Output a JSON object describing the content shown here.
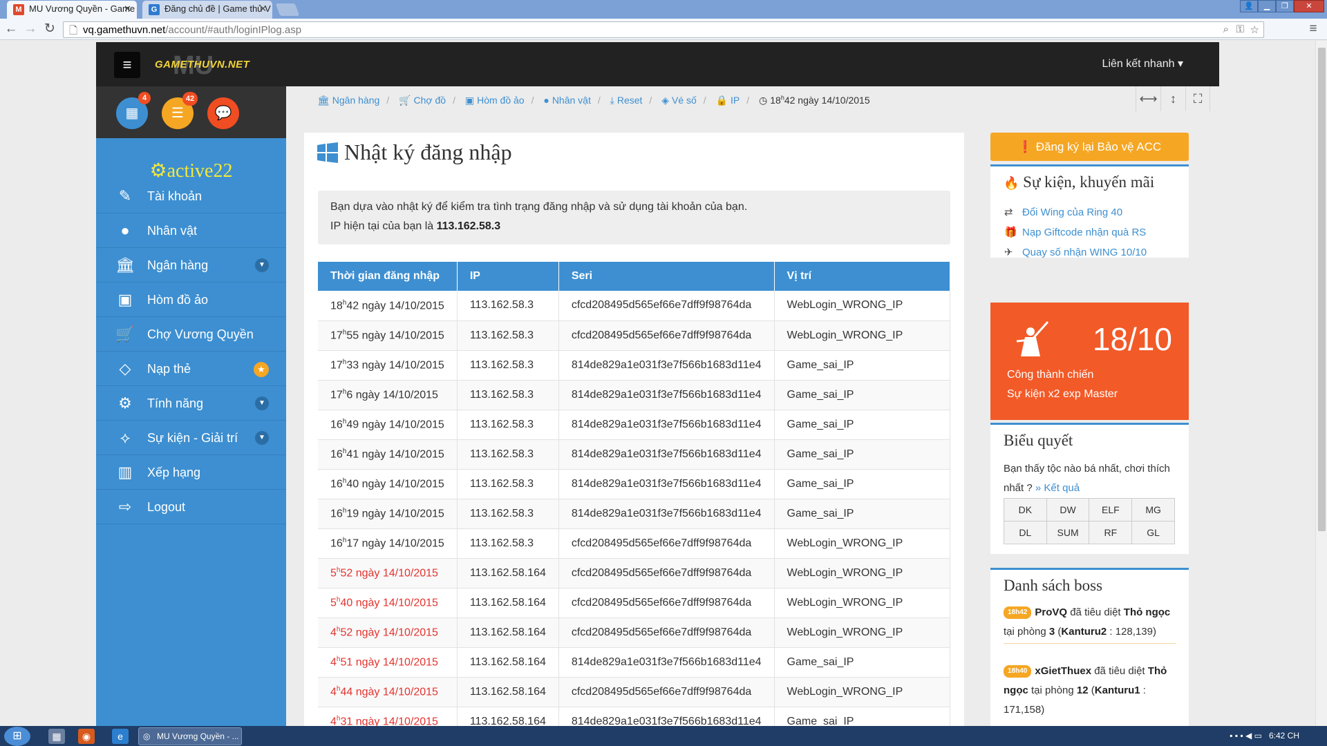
{
  "browser": {
    "tabs": [
      {
        "title": "MU Vương Quyền - Game",
        "close": "✕"
      },
      {
        "title": "Đăng chủ đề | Game thủ V",
        "close": "✕"
      }
    ],
    "url_host": "vq.gamethuvn.net",
    "url_path": "/account/#auth/loginIPlog.asp"
  },
  "header": {
    "logo_text": "GAMETHUVN.NET",
    "quick_links": "Liên kết nhanh ▾"
  },
  "sidebar": {
    "badges": [
      "4",
      "42"
    ],
    "username": "active22",
    "items": [
      {
        "label": "Tài khoản",
        "icon": "edit-icon"
      },
      {
        "label": "Nhân vật",
        "icon": "user-icon"
      },
      {
        "label": "Ngân hàng",
        "icon": "bank-icon"
      },
      {
        "label": "Hòm đồ ảo",
        "icon": "briefcase-icon"
      },
      {
        "label": "Chợ Vương Quyền",
        "icon": "cart-icon"
      },
      {
        "label": "Nạp thẻ",
        "icon": "diamond-icon"
      },
      {
        "label": "Tính năng",
        "icon": "gears-icon"
      },
      {
        "label": "Sự kiện - Giải trí",
        "icon": "handshake-icon"
      },
      {
        "label": "Xếp hạng",
        "icon": "bar-chart-icon"
      },
      {
        "label": "Logout",
        "icon": "logout-icon"
      }
    ]
  },
  "breadcrumbs": [
    {
      "label": "Ngân hàng"
    },
    {
      "label": "Chợ đồ"
    },
    {
      "label": "Hòm đồ ảo"
    },
    {
      "label": "Nhân vật"
    },
    {
      "label": "Reset"
    },
    {
      "label": "Vé số"
    },
    {
      "label": "IP"
    }
  ],
  "clock": {
    "hour": "18",
    "unit": "h",
    "rest": "42 ngày 14/10/2015"
  },
  "main": {
    "title": "Nhật ký đăng nhập",
    "info_line1": "Bạn dựa vào nhật ký để kiểm tra tình trạng đăng nhập và sử dụng tài khoản của bạn.",
    "info_line2_prefix": "IP hiện tại của bạn là ",
    "current_ip": "113.162.58.3"
  },
  "table": {
    "headers": [
      "Thời gian đăng nhập",
      "IP",
      "Seri",
      "Vị trí"
    ],
    "rows": [
      {
        "h": "18",
        "rest": "42 ngày 14/10/2015",
        "ip": "113.162.58.3",
        "seri": "cfcd208495d565ef66e7dff9f98764da",
        "pos": "WebLogin_WRONG_IP",
        "warn": false
      },
      {
        "h": "17",
        "rest": "55 ngày 14/10/2015",
        "ip": "113.162.58.3",
        "seri": "cfcd208495d565ef66e7dff9f98764da",
        "pos": "WebLogin_WRONG_IP",
        "warn": false
      },
      {
        "h": "17",
        "rest": "33 ngày 14/10/2015",
        "ip": "113.162.58.3",
        "seri": "814de829a1e031f3e7f566b1683d11e4",
        "pos": "Game_sai_IP",
        "warn": false
      },
      {
        "h": "17",
        "rest": "6 ngày 14/10/2015",
        "ip": "113.162.58.3",
        "seri": "814de829a1e031f3e7f566b1683d11e4",
        "pos": "Game_sai_IP",
        "warn": false
      },
      {
        "h": "16",
        "rest": "49 ngày 14/10/2015",
        "ip": "113.162.58.3",
        "seri": "814de829a1e031f3e7f566b1683d11e4",
        "pos": "Game_sai_IP",
        "warn": false
      },
      {
        "h": "16",
        "rest": "41 ngày 14/10/2015",
        "ip": "113.162.58.3",
        "seri": "814de829a1e031f3e7f566b1683d11e4",
        "pos": "Game_sai_IP",
        "warn": false
      },
      {
        "h": "16",
        "rest": "40 ngày 14/10/2015",
        "ip": "113.162.58.3",
        "seri": "814de829a1e031f3e7f566b1683d11e4",
        "pos": "Game_sai_IP",
        "warn": false
      },
      {
        "h": "16",
        "rest": "19 ngày 14/10/2015",
        "ip": "113.162.58.3",
        "seri": "814de829a1e031f3e7f566b1683d11e4",
        "pos": "Game_sai_IP",
        "warn": false
      },
      {
        "h": "16",
        "rest": "17 ngày 14/10/2015",
        "ip": "113.162.58.3",
        "seri": "cfcd208495d565ef66e7dff9f98764da",
        "pos": "WebLogin_WRONG_IP",
        "warn": false
      },
      {
        "h": "5",
        "rest": "52 ngày 14/10/2015",
        "ip": "113.162.58.164",
        "seri": "cfcd208495d565ef66e7dff9f98764da",
        "pos": "WebLogin_WRONG_IP",
        "warn": true
      },
      {
        "h": "5",
        "rest": "40 ngày 14/10/2015",
        "ip": "113.162.58.164",
        "seri": "cfcd208495d565ef66e7dff9f98764da",
        "pos": "WebLogin_WRONG_IP",
        "warn": true
      },
      {
        "h": "4",
        "rest": "52 ngày 14/10/2015",
        "ip": "113.162.58.164",
        "seri": "cfcd208495d565ef66e7dff9f98764da",
        "pos": "WebLogin_WRONG_IP",
        "warn": true
      },
      {
        "h": "4",
        "rest": "51 ngày 14/10/2015",
        "ip": "113.162.58.164",
        "seri": "814de829a1e031f3e7f566b1683d11e4",
        "pos": "Game_sai_IP",
        "warn": true
      },
      {
        "h": "4",
        "rest": "44 ngày 14/10/2015",
        "ip": "113.162.58.164",
        "seri": "cfcd208495d565ef66e7dff9f98764da",
        "pos": "WebLogin_WRONG_IP",
        "warn": true
      },
      {
        "h": "4",
        "rest": "31 ngày 14/10/2015",
        "ip": "113.162.58.164",
        "seri": "814de829a1e031f3e7f566b1683d11e4",
        "pos": "Game_sai_IP",
        "warn": true
      }
    ],
    "hour_unit": "h"
  },
  "right": {
    "register_button": "Đăng ký lại Bảo vệ ACC",
    "events_title": "Sự kiện, khuyến mãi",
    "events": [
      {
        "label": "Đổi Wing của Ring 40",
        "icon": "exchange-icon"
      },
      {
        "label": "Nạp Giftcode nhận quà RS",
        "icon": "gift-icon"
      },
      {
        "label": "Quay số nhận WING 10/10",
        "icon": "plane-icon"
      }
    ],
    "castle": {
      "date": "18/10",
      "line1": "Công thành chiến",
      "line2": "Sự kiện x2 exp Master"
    },
    "poll": {
      "title": "Biểu quyết",
      "question": "Bạn thấy tộc nào bá nhất, chơi thích nhất ?",
      "result_link": "» Kết quả",
      "options": [
        "DK",
        "DW",
        "ELF",
        "MG",
        "DL",
        "SUM",
        "RF",
        "GL"
      ]
    },
    "boss": {
      "title": "Danh sách boss",
      "entries": [
        {
          "time": "18h42",
          "player": "ProVQ",
          "verb": " đã tiêu diệt ",
          "boss": "Thỏ ngọc",
          "at": " tại phòng ",
          "room": "3",
          "loc": "Kanturu2",
          "coords": " : 128,139)"
        },
        {
          "time": "18h40",
          "player": "xGietThuex",
          "verb": " đã tiêu diệt ",
          "boss": "Thỏ ngọc",
          "at": " tại phòng ",
          "room": "12",
          "loc": "Kanturu1",
          "coords": " : 171,158)"
        }
      ]
    }
  },
  "taskbar": {
    "chrome_item": "MU Vương Quyền - ...",
    "time": "6:42 CH"
  },
  "colors": {
    "accent": "#3d8fd1",
    "warning": "#f5a623",
    "danger_red": "#e3342f",
    "castle_orange": "#f25a28",
    "username_yellow": "#f4e93a"
  }
}
